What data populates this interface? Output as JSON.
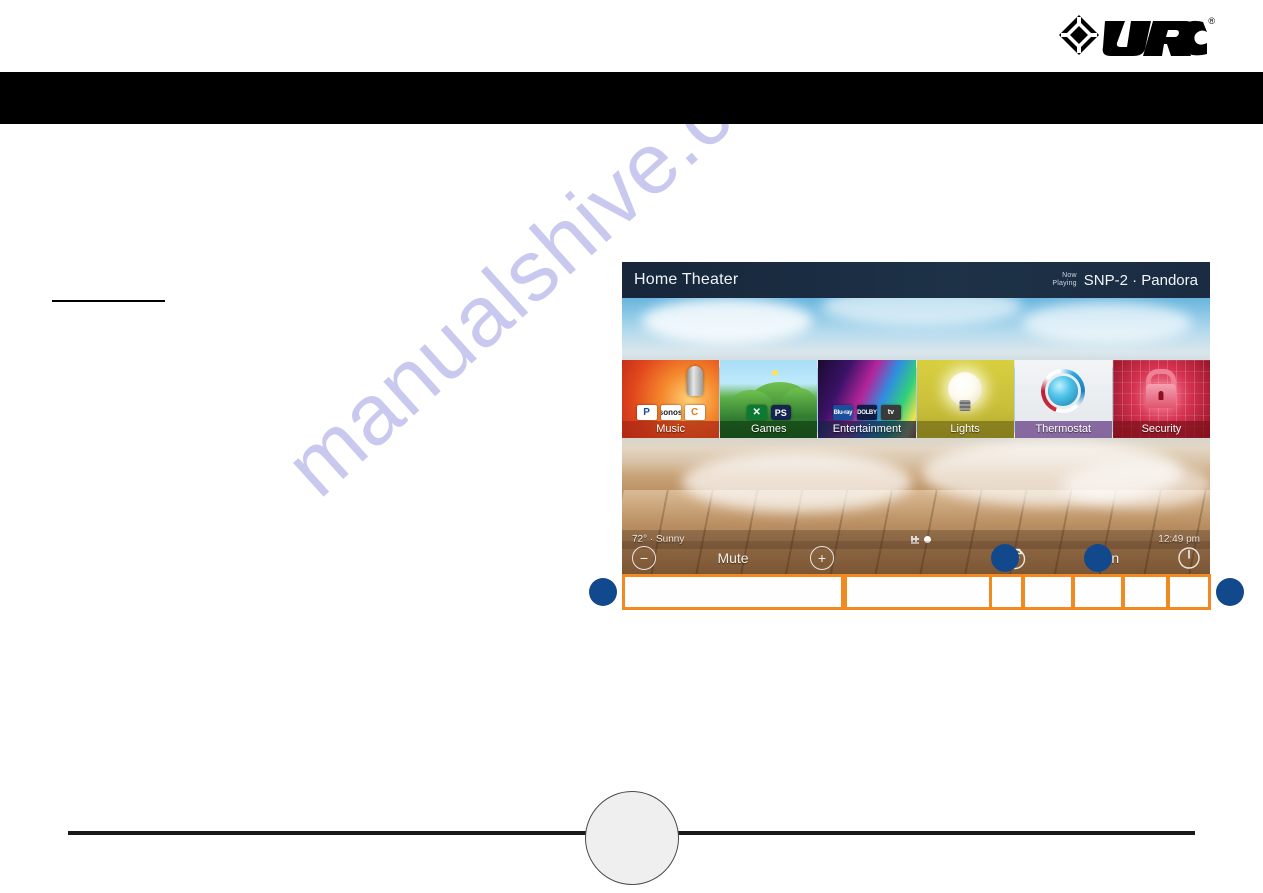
{
  "brand": {
    "logo_text": "URC",
    "registered_mark": "®"
  },
  "document": {
    "section_heading": "",
    "body_text": "",
    "page_number": ""
  },
  "watermark": {
    "text": "manualshive.com"
  },
  "device_screen": {
    "header": {
      "title": "Home Theater",
      "now_playing_label_line1": "Now",
      "now_playing_label_line2": "Playing",
      "now_playing_value": "SNP-2 · Pandora"
    },
    "tiles": [
      {
        "label": "Music",
        "art": "art-music",
        "label_bg": "lbl-music",
        "subicons": [
          {
            "text": "P",
            "cls": "si-pandora"
          },
          {
            "text": "sonos",
            "cls": "si-sonos"
          },
          {
            "text": "C",
            "cls": "si-spotify"
          }
        ]
      },
      {
        "label": "Games",
        "art": "art-games",
        "label_bg": "lbl-games",
        "subicons": [
          {
            "text": "✕",
            "cls": "si-xbox"
          },
          {
            "text": "PS",
            "cls": "si-ps"
          }
        ]
      },
      {
        "label": "Entertainment",
        "art": "art-ent",
        "label_bg": "lbl-ent",
        "subicons": [
          {
            "text": "Blu-ray",
            "cls": "si-bluray"
          },
          {
            "text": "DOLBY",
            "cls": "si-dolby"
          },
          {
            "text": "tv",
            "cls": "si-atv"
          }
        ]
      },
      {
        "label": "Lights",
        "art": "art-lights",
        "label_bg": "lbl-lights",
        "subicons": []
      },
      {
        "label": "Thermostat",
        "art": "art-thermo",
        "label_bg": "lbl-thermo",
        "subicons": []
      },
      {
        "label": "Security",
        "art": "art-security",
        "label_bg": "lbl-security",
        "subicons": []
      }
    ],
    "status_bar": {
      "weather": "72° · Sunny",
      "time": "12:49 pm",
      "page_indicator_active_index": 1,
      "page_indicator_count": 2
    },
    "controls": {
      "volume_down_icon": "−",
      "mute_label": "Mute",
      "volume_up_icon": "+",
      "menu_icon": "menu-circle-icon",
      "main_label": "Main",
      "power_icon": "power-icon"
    }
  },
  "callouts": {
    "accent_color": "#F18A21",
    "marker_color": "#12488C",
    "marker_count": 4,
    "box_count": 7
  }
}
